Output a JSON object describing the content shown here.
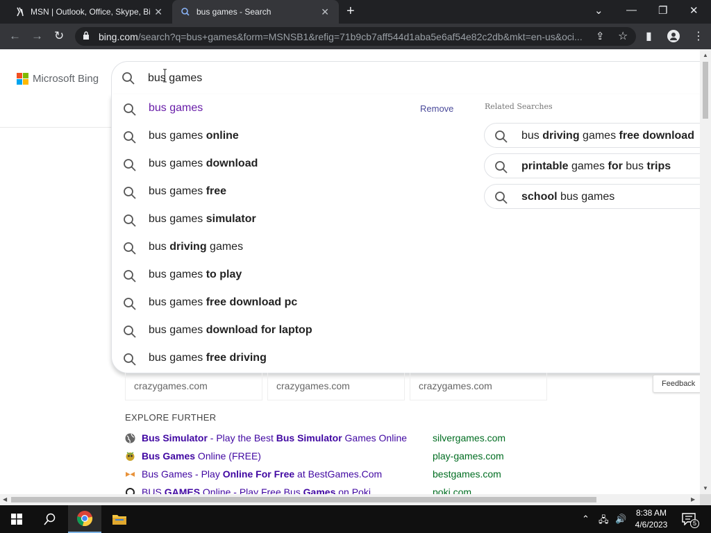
{
  "browser": {
    "tabs": [
      {
        "title": "MSN | Outlook, Office, Skype, Bing, Breaking News, and Latest Videos",
        "active": false
      },
      {
        "title": "bus games - Search",
        "active": true
      }
    ],
    "url_host": "bing.com",
    "url_rest": "/search?q=bus+games&form=MSNSB1&refig=71b9cb7aff544d1aba5e6af54e82c2db&mkt=en-us&oci..."
  },
  "header": {
    "logo_text": "Microsoft Bing"
  },
  "search": {
    "query": "bus games"
  },
  "suggestions": {
    "remove_label": "Remove",
    "items": [
      {
        "plain": "bus games",
        "bold": "",
        "tail": "",
        "visited": true
      },
      {
        "plain": "bus games ",
        "bold": "online",
        "tail": ""
      },
      {
        "plain": "bus games ",
        "bold": "download",
        "tail": ""
      },
      {
        "plain": "bus games ",
        "bold": "free",
        "tail": ""
      },
      {
        "plain": "bus games ",
        "bold": "simulator",
        "tail": ""
      },
      {
        "plain": "bus ",
        "bold": "driving",
        "tail": " games"
      },
      {
        "plain": "bus games ",
        "bold": "to play",
        "tail": ""
      },
      {
        "plain": "bus games ",
        "bold": "free download pc",
        "tail": ""
      },
      {
        "plain": "bus games ",
        "bold": "download for laptop",
        "tail": ""
      },
      {
        "plain": "bus games ",
        "bold": "free driving",
        "tail": ""
      }
    ]
  },
  "related": {
    "label": "Related Searches",
    "items": [
      {
        "parts": [
          [
            "bus ",
            false
          ],
          [
            "driving",
            true
          ],
          [
            " games ",
            false
          ],
          [
            "free download",
            true
          ]
        ]
      },
      {
        "parts": [
          [
            "printable",
            true
          ],
          [
            " games ",
            false
          ],
          [
            "for",
            true
          ],
          [
            " bus ",
            false
          ],
          [
            "trips",
            true
          ]
        ]
      },
      {
        "parts": [
          [
            "school",
            true
          ],
          [
            " bus games",
            false
          ]
        ]
      }
    ]
  },
  "results": {
    "card_sources": [
      "crazygames.com",
      "crazygames.com",
      "crazygames.com"
    ],
    "feedback_label": "Feedback",
    "explore_title": "EXPLORE FURTHER",
    "explore": [
      {
        "parts": [
          [
            "Bus Simulator",
            true
          ],
          [
            " - Play the Best ",
            false
          ],
          [
            "Bus Simulator",
            true
          ],
          [
            " Games Online",
            false
          ]
        ],
        "domain": "silvergames.com",
        "icon": "globe-icon"
      },
      {
        "parts": [
          [
            "Bus Games",
            true
          ],
          [
            " Online (FREE)",
            false
          ]
        ],
        "domain": "play-games.com",
        "icon": "playgames-icon"
      },
      {
        "parts": [
          [
            "Bus Games - Play ",
            false
          ],
          [
            "Online For Free",
            true
          ],
          [
            " at BestGames.Com",
            false
          ]
        ],
        "domain": "bestgames.com",
        "icon": "bestgames-icon"
      },
      {
        "parts": [
          [
            "BUS ",
            false
          ],
          [
            "GAMES",
            true
          ],
          [
            " Online - Play Free Bus ",
            false
          ],
          [
            "Games",
            true
          ],
          [
            " on Poki",
            false
          ]
        ],
        "domain": "poki.com",
        "icon": "poki-icon"
      }
    ]
  },
  "taskbar": {
    "time": "8:38 AM",
    "date": "4/6/2023",
    "notifications": "5"
  },
  "colors": {
    "chrome_dark": "#202124",
    "chrome_mid": "#35363a",
    "link": "#4007a2",
    "domain_green": "#006d21",
    "visited": "#681da8"
  }
}
